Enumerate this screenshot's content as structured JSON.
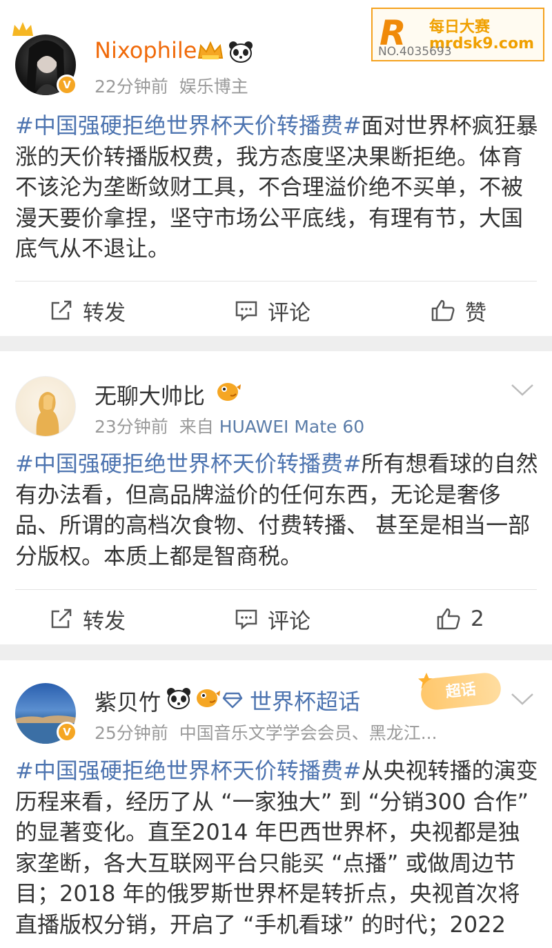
{
  "watermark": {
    "logo_letter": "R",
    "title": "每日大赛",
    "url": "mrdsk9.com",
    "number": "NO.4035693"
  },
  "posts": [
    {
      "name": "Nixophile",
      "time": "22分钟前",
      "source": "娱乐博主",
      "hashtag": "#中国强硬拒绝世界杯天价转播费#",
      "text": "面对世界杯疯狂暴涨的天价转播版权费，我方态度坚决果断拒绝。体育不该沦为垄断敛财工具，不合理溢价绝不买单，不被漫天要价拿捏，坚守市场公平底线，有理有节，大国底气从不退让。",
      "repost_label": "转发",
      "comment_label": "评论",
      "like_label": "赞",
      "verified_badge": "V"
    },
    {
      "name": "无聊大帅比",
      "time": "23分钟前",
      "source_prefix": "来自",
      "source": "HUAWEI Mate 60",
      "hashtag": "#中国强硬拒绝世界杯天价转播费#",
      "text": "所有想看球的自然有办法看，但高品牌溢价的任何东西，无论是奢侈品、所谓的高档次食物、付费转播、 甚至是相当一部分版权。本质上都是智商税。",
      "repost_label": "转发",
      "comment_label": "评论",
      "like_count": "2"
    },
    {
      "name": "紫贝竹",
      "topic": "世界杯超话",
      "chaohua_badge": "超话",
      "time": "25分钟前",
      "source": "中国音乐文学学会会员、黑龙江...",
      "hashtag": "#中国强硬拒绝世界杯天价转播费#",
      "text": "从央视转播的演变历程来看，经历了从 “一家独大” 到 “分销300 合作” 的显著变化。直至2014 年巴西世界杯，央视都是独家垄断，各大互联网平台只能买 “点播” 或做周边节目；2018 年的俄罗斯世界杯是转折点，央视首次将直播版权分销，开启了 “手机看球” 的时代；2022",
      "verified_badge": "V"
    }
  ],
  "colors": {
    "hashtag": "#4d74b0",
    "vip_name": "#f06a0a",
    "meta": "#9a9a9a",
    "separator": "#eeeeee",
    "watermark": "#f5a11c"
  },
  "icons": [
    "crown-icon",
    "panda-icon",
    "fish-icon",
    "repost-icon",
    "comment-icon",
    "like-icon",
    "chevron-down-icon",
    "diamond-icon",
    "star-icon"
  ]
}
